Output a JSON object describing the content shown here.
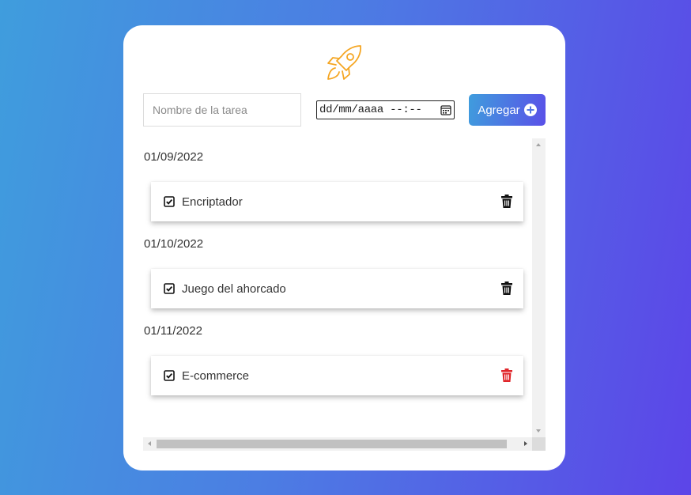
{
  "form": {
    "task_placeholder": "Nombre de la tarea",
    "task_value": "",
    "date_placeholder": "dd/mm/aaaa --:--",
    "add_label": "Agregar"
  },
  "groups": [
    {
      "date": "01/09/2022",
      "tasks": [
        {
          "label": "Encriptador",
          "done": true,
          "trash_color": "#111111"
        }
      ]
    },
    {
      "date": "01/10/2022",
      "tasks": [
        {
          "label": "Juego del ahorcado",
          "done": true,
          "trash_color": "#111111"
        }
      ]
    },
    {
      "date": "01/11/2022",
      "tasks": [
        {
          "label": "E-commerce",
          "done": true,
          "trash_color": "#e0262b"
        }
      ]
    }
  ],
  "icons": {
    "logo": "rocket-icon",
    "add": "plus-circle-icon",
    "calendar": "calendar-icon",
    "check": "checkbox-checked-icon",
    "delete": "trash-icon"
  },
  "colors": {
    "gradient_start": "#3f9ddd",
    "gradient_end": "#5c45e8",
    "rocket": "#f5a623",
    "trash_hover": "#e0262b"
  }
}
